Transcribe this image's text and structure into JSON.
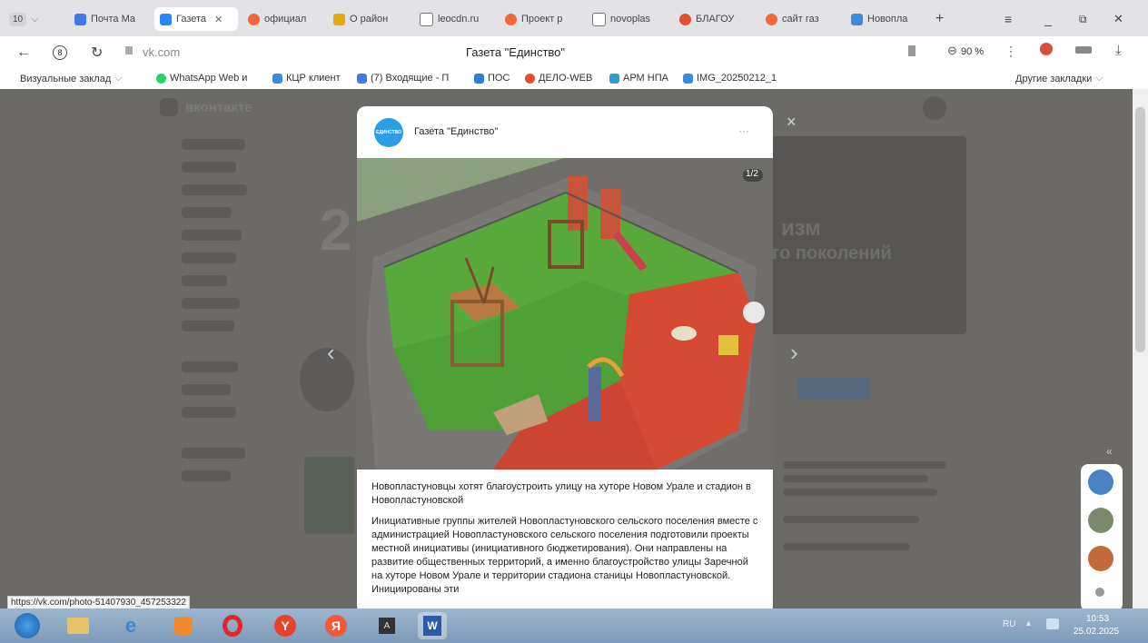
{
  "tabs": {
    "count": "10",
    "items": [
      {
        "label": "Почта Ма",
        "color": "#3d7be6"
      },
      {
        "label": "Газета",
        "color": "#2787f5"
      },
      {
        "label": "официал",
        "color": "#f2683a"
      },
      {
        "label": "О район",
        "color": "#e5a90e"
      },
      {
        "label": "leocdn.ru",
        "color": "#777777"
      },
      {
        "label": "Проект р",
        "color": "#f2683a"
      },
      {
        "label": "novoplas",
        "color": "#777777"
      },
      {
        "label": "БЛАГОУ",
        "color": "#e0502d"
      },
      {
        "label": "сайт газ",
        "color": "#f2683a"
      },
      {
        "label": "Новопла",
        "color": "#3a8be0"
      }
    ],
    "new_tab": "+"
  },
  "window": {
    "menu": "≡",
    "minimize": "_",
    "restore": "⧉",
    "close": "✕"
  },
  "address": {
    "url": "vk.com",
    "title": "Газета \"Единство\"",
    "zoom": "90 %",
    "menu": "⋮"
  },
  "bookmarks": {
    "items": [
      {
        "label": "Визуальные заклад",
        "color": "#777777"
      },
      {
        "label": "WhatsApp Web и",
        "color": "#25d366"
      },
      {
        "label": "КЦР клиент",
        "color": "#3a8be0"
      },
      {
        "label": "(7) Входящие - П",
        "color": "#3d7be6"
      },
      {
        "label": "ПОС",
        "color": "#2d7fd6"
      },
      {
        "label": "ДЕЛО-WEB",
        "color": "#e0502d"
      },
      {
        "label": "АРМ НПА",
        "color": "#2d9fd6"
      },
      {
        "label": "IMG_20250212_1",
        "color": "#3a8be0"
      }
    ],
    "other": "Другие закладки"
  },
  "post": {
    "author": "Газета \"Единство\"",
    "avatar_text": "ЕДИНСТВО",
    "more": "···",
    "counter": "1/2",
    "close": "×",
    "title": "Новопластуновцы хотят благоустроить улицу на хуторе Новом Урале и стадион в Новопластуновской",
    "body": "Инициативные группы жителей Новопластуновского сельского поселения вместе с администрацией Новопластуновского сельского поселения подготовили проекты местной инициативы (инициативного бюджетирования). Они направлены на развитие общественных территорий, а именно благоустройство улицы Заречной на хуторе Новом Урале и территории стадиона станицы Новопластуновской. Инициированы эти"
  },
  "background_page": {
    "logo": "вконтакте",
    "big_number": "2",
    "headline_1": "изм",
    "headline_2": "го поколений"
  },
  "status_url": "https://vk.com/photo-51407930_457253322",
  "taskbar": {
    "lang": "RU",
    "time": "10:53",
    "date": "25.02.2025"
  }
}
